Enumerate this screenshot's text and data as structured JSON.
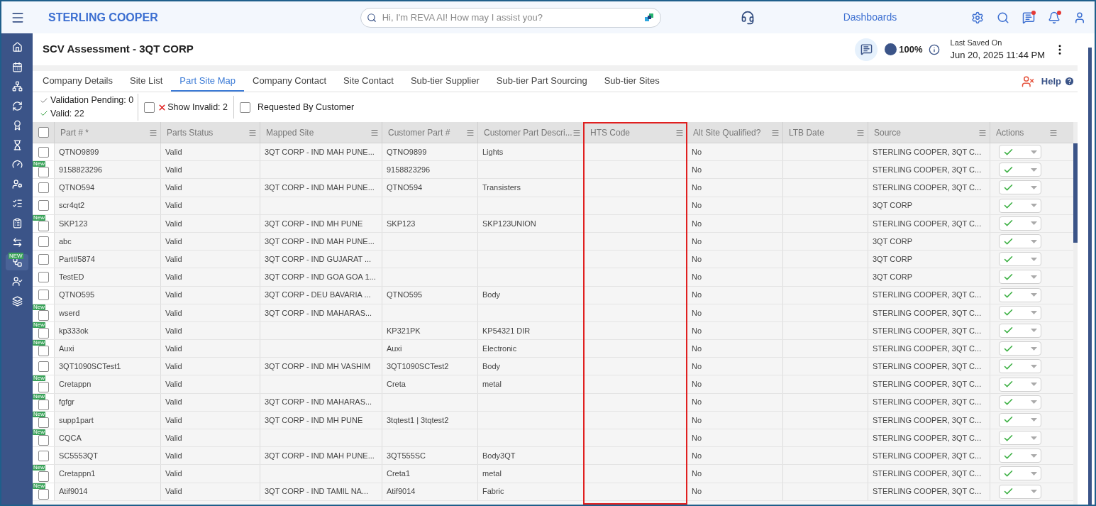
{
  "topbar": {
    "brand": "STERLING COOPER",
    "search": {
      "placeholder": "Hi, I'm REVA AI! How may I assist you?"
    },
    "link": "Dashboards",
    "notifications": [
      {
        "kind": "settings",
        "dot": false
      },
      {
        "kind": "search",
        "dot": false
      },
      {
        "kind": "messages",
        "dot": true
      },
      {
        "kind": "bell",
        "dot": true
      },
      {
        "kind": "user",
        "dot": false
      }
    ]
  },
  "sidebar": {
    "items": [
      {
        "kind": "home",
        "selected": false
      },
      {
        "kind": "calendar",
        "selected": false
      },
      {
        "kind": "hierarchy",
        "selected": false
      },
      {
        "kind": "cycle",
        "selected": false
      },
      {
        "kind": "award",
        "selected": false
      },
      {
        "kind": "hourglass",
        "selected": false
      },
      {
        "kind": "gauge",
        "selected": false
      },
      {
        "kind": "user-gear",
        "selected": false
      },
      {
        "kind": "checklist",
        "selected": false
      },
      {
        "kind": "clipboard",
        "selected": false
      },
      {
        "kind": "transfer",
        "selected": false
      },
      {
        "kind": "network",
        "selected": true,
        "badge": "NEW"
      },
      {
        "kind": "user-tag",
        "selected": false
      },
      {
        "kind": "podium",
        "selected": false
      }
    ]
  },
  "header": {
    "title": "SCV Assessment - 3QT CORP",
    "progress": "100%",
    "saved_label": "Last Saved On",
    "saved_time": "Jun 20, 2025 11:44 PM"
  },
  "tabs": [
    {
      "label": "Company Details",
      "selected": false
    },
    {
      "label": "Site List",
      "selected": false
    },
    {
      "label": "Part Site Map",
      "selected": true
    },
    {
      "label": "Company Contact",
      "selected": false
    },
    {
      "label": "Site Contact",
      "selected": false
    },
    {
      "label": "Sub-tier Supplier",
      "selected": false
    },
    {
      "label": "Sub-tier Part Sourcing",
      "selected": false
    },
    {
      "label": "Sub-tier Sites",
      "selected": false
    }
  ],
  "help": "Help",
  "filters": {
    "pending": "Validation Pending: 0",
    "valid": "Valid: 22",
    "show_invalid": {
      "label": "Show Invalid: 2",
      "checked": false
    },
    "requested": {
      "label": "Requested By Customer",
      "checked": false
    }
  },
  "table": {
    "select_all": false,
    "columns": [
      {
        "label": "Part # *",
        "highlighted": false
      },
      {
        "label": "Parts Status",
        "highlighted": false
      },
      {
        "label": "Mapped Site",
        "highlighted": false
      },
      {
        "label": "Customer Part #",
        "highlighted": false
      },
      {
        "label": "Customer Part Descri...",
        "highlighted": false
      },
      {
        "label": "HTS Code",
        "highlighted": true
      },
      {
        "label": "Alt Site Qualified?",
        "highlighted": false
      },
      {
        "label": "LTB Date",
        "highlighted": false
      },
      {
        "label": "Source",
        "highlighted": false
      },
      {
        "label": "Actions",
        "highlighted": false
      }
    ],
    "rows": [
      {
        "checked": false,
        "badge": "",
        "cells": [
          "QTNO9899",
          "Valid",
          "3QT CORP - IND MAH PUNE...",
          "QTNO9899",
          "Lights",
          "",
          "No",
          "",
          "STERLING COOPER, 3QT C..."
        ]
      },
      {
        "checked": false,
        "badge": "New",
        "cells": [
          "9158823296",
          "Valid",
          "",
          "9158823296",
          "",
          "",
          "No",
          "",
          "STERLING COOPER, 3QT C..."
        ]
      },
      {
        "checked": false,
        "badge": "",
        "cells": [
          "QTNO594",
          "Valid",
          "3QT CORP - IND MAH PUNE...",
          "QTNO594",
          "Transisters",
          "",
          "No",
          "",
          "STERLING COOPER, 3QT C..."
        ]
      },
      {
        "checked": false,
        "badge": "",
        "cells": [
          "scr4qt2",
          "Valid",
          "",
          "",
          "",
          "",
          "No",
          "",
          "3QT CORP"
        ]
      },
      {
        "checked": false,
        "badge": "New",
        "cells": [
          "SKP123",
          "Valid",
          "3QT CORP - IND MH PUNE",
          "SKP123",
          "SKP123UNION",
          "",
          "No",
          "",
          "STERLING COOPER, 3QT C..."
        ]
      },
      {
        "checked": false,
        "badge": "",
        "cells": [
          "abc",
          "Valid",
          "3QT CORP - IND MAH PUNE...",
          "",
          "",
          "",
          "No",
          "",
          "3QT CORP"
        ]
      },
      {
        "checked": false,
        "badge": "",
        "cells": [
          "Part#5874",
          "Valid",
          "3QT CORP - IND GUJARAT ...",
          "",
          "",
          "",
          "No",
          "",
          "3QT CORP"
        ]
      },
      {
        "checked": false,
        "badge": "",
        "cells": [
          "TestED",
          "Valid",
          "3QT CORP - IND GOA GOA 1...",
          "",
          "",
          "",
          "No",
          "",
          "3QT CORP"
        ]
      },
      {
        "checked": false,
        "badge": "",
        "cells": [
          "QTNO595",
          "Valid",
          "3QT CORP - DEU BAVARIA ...",
          "QTNO595",
          "Body",
          "",
          "No",
          "",
          "STERLING COOPER, 3QT C..."
        ]
      },
      {
        "checked": false,
        "badge": "New",
        "cells": [
          "wserd",
          "Valid",
          "3QT CORP - IND MAHARAS...",
          "",
          "",
          "",
          "No",
          "",
          "STERLING COOPER, 3QT C..."
        ]
      },
      {
        "checked": false,
        "badge": "New",
        "cells": [
          "kp333ok",
          "Valid",
          "",
          "KP321PK",
          "KP54321 DIR",
          "",
          "No",
          "",
          "STERLING COOPER, 3QT C..."
        ]
      },
      {
        "checked": false,
        "badge": "New",
        "cells": [
          "Auxi",
          "Valid",
          "",
          "Auxi",
          "Electronic",
          "",
          "No",
          "",
          "STERLING COOPER, 3QT C..."
        ]
      },
      {
        "checked": false,
        "badge": "",
        "cells": [
          "3QT1090SCTest1",
          "Valid",
          "3QT CORP - IND MH VASHIM",
          "3QT1090SCTest2",
          "Body",
          "",
          "No",
          "",
          "STERLING COOPER, 3QT C..."
        ]
      },
      {
        "checked": false,
        "badge": "New",
        "cells": [
          "Cretappn",
          "Valid",
          "",
          "Creta",
          "metal",
          "",
          "No",
          "",
          "STERLING COOPER, 3QT C..."
        ]
      },
      {
        "checked": false,
        "badge": "New",
        "cells": [
          "fgfgr",
          "Valid",
          "3QT CORP - IND MAHARAS...",
          "",
          "",
          "",
          "No",
          "",
          "STERLING COOPER, 3QT C..."
        ]
      },
      {
        "checked": false,
        "badge": "New",
        "cells": [
          "supp1part",
          "Valid",
          "3QT CORP - IND MH PUNE",
          "3tqtest1 | 3tqtest2",
          "",
          "",
          "No",
          "",
          "STERLING COOPER, 3QT C..."
        ]
      },
      {
        "checked": false,
        "badge": "New",
        "cells": [
          "CQCA",
          "Valid",
          "",
          "",
          "",
          "",
          "No",
          "",
          "STERLING COOPER, 3QT C..."
        ]
      },
      {
        "checked": false,
        "badge": "",
        "cells": [
          "SC5553QT",
          "Valid",
          "3QT CORP - IND MAH PUNE...",
          "3QT555SC",
          "Body3QT",
          "",
          "No",
          "",
          "STERLING COOPER, 3QT C..."
        ]
      },
      {
        "checked": false,
        "badge": "New",
        "cells": [
          "Cretappn1",
          "Valid",
          "",
          "Creta1",
          "metal",
          "",
          "No",
          "",
          "STERLING COOPER, 3QT C..."
        ]
      },
      {
        "checked": false,
        "badge": "New",
        "cells": [
          "Atif9014",
          "Valid",
          "3QT CORP - IND TAMIL NA...",
          "Atif9014",
          "Fabric",
          "",
          "No",
          "",
          "STERLING COOPER, 3QT C..."
        ]
      }
    ]
  }
}
